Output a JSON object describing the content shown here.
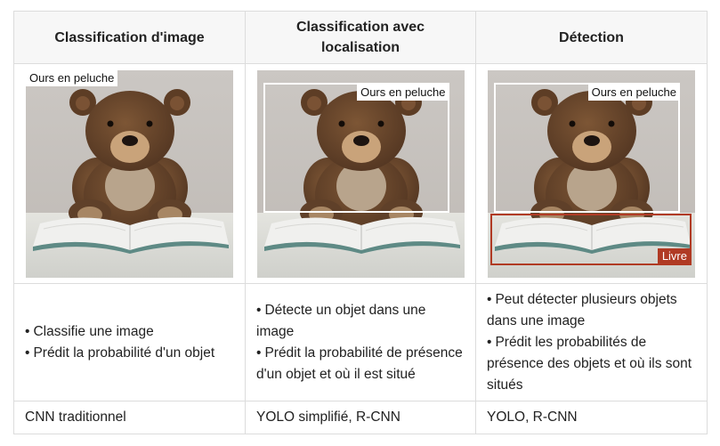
{
  "header": {
    "col1": "Classification d'image",
    "col2_line1": "Classification avec",
    "col2_line2": "localisation",
    "col3": "Détection"
  },
  "images": {
    "col1_label": "Ours en peluche",
    "col2_label": "Ours en peluche",
    "col3_label_bear": "Ours en peluche",
    "col3_label_book": "Livre",
    "colors": {
      "wall": "#c9c5c1",
      "bear": "#6e4a2f",
      "muzzle": "#c9a37a",
      "book_pages": "#eeeeec",
      "sheet": "#ddddd8",
      "detection_box": "#b03a24",
      "localisation_box": "#ffffff"
    }
  },
  "descriptions": {
    "col1": [
      "Classifie une image",
      "Prédit la probabilité d'un objet"
    ],
    "col2": [
      "Détecte un objet dans une image",
      "Prédit la probabilité de présence d'un objet et où il est situé"
    ],
    "col3": [
      "Peut détecter plusieurs objets dans une image",
      "Prédit les probabilités de présence des objets et où ils sont situés"
    ],
    "bullet": "•"
  },
  "models": {
    "col1": "CNN traditionnel",
    "col2": "YOLO simplifié, R-CNN",
    "col3": "YOLO, R-CNN"
  }
}
